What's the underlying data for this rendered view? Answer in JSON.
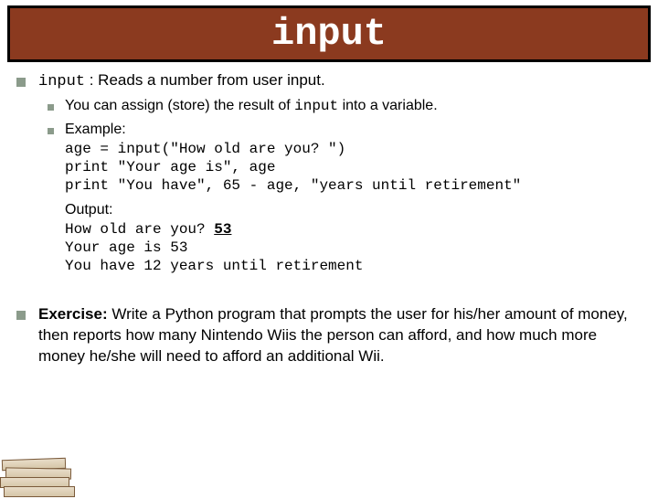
{
  "title": "input",
  "intro": {
    "keyword": "input",
    "rest": " : Reads a number from user input."
  },
  "sub": [
    {
      "pre": "You can assign (store) the result of ",
      "kw": "input",
      "post": " into a variable."
    },
    {
      "pre": "Example:",
      "kw": "",
      "post": ""
    }
  ],
  "code_lines": [
    "age = input(\"How old are you? \")",
    "print \"Your age is\", age",
    "print \"You have\", 65 - age, \"years until retirement\""
  ],
  "output_label": "Output:",
  "output": {
    "prompt": "How old are you? ",
    "user_input": "53",
    "lines": [
      "Your age is 53",
      "You have 12 years until retirement"
    ]
  },
  "exercise": {
    "label": "Exercise:",
    "text": " Write a Python program that prompts the user for his/her amount of money, then reports how many Nintendo Wiis the person can afford, and how much more money he/she will need to afford an additional Wii."
  }
}
